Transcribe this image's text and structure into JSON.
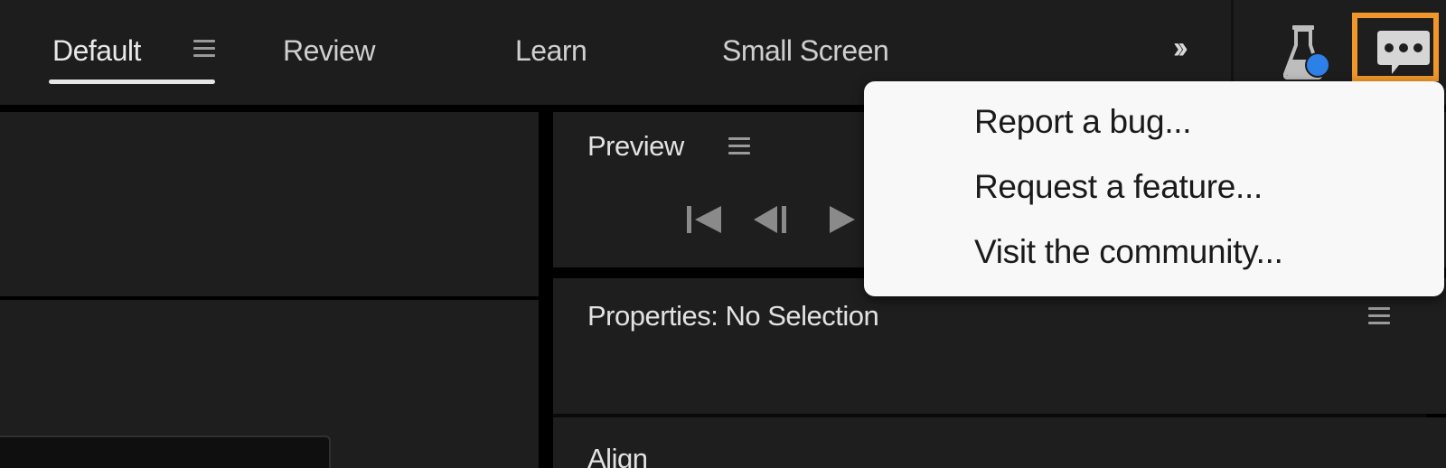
{
  "workspace_bar": {
    "tabs": [
      {
        "label": "Default",
        "active": true
      },
      {
        "label": "Review",
        "active": false
      },
      {
        "label": "Learn",
        "active": false
      },
      {
        "label": "Small Screen",
        "active": false
      }
    ],
    "overflow_icon": "double-chevron-right",
    "beta_icon": "flask-icon",
    "feedback_icon": "speech-bubble-ellipsis-icon",
    "feedback_highlight_color": "#f0962a",
    "beta_badge_color": "#2d80e8"
  },
  "feedback_menu": {
    "items": [
      {
        "label": "Report a bug..."
      },
      {
        "label": "Request a feature..."
      },
      {
        "label": "Visit the community..."
      }
    ]
  },
  "panels": {
    "preview": {
      "title": "Preview",
      "controls": [
        "go-to-first-frame",
        "step-back",
        "play"
      ]
    },
    "properties": {
      "title": "Properties: No Selection"
    },
    "align": {
      "title": "Align"
    }
  }
}
